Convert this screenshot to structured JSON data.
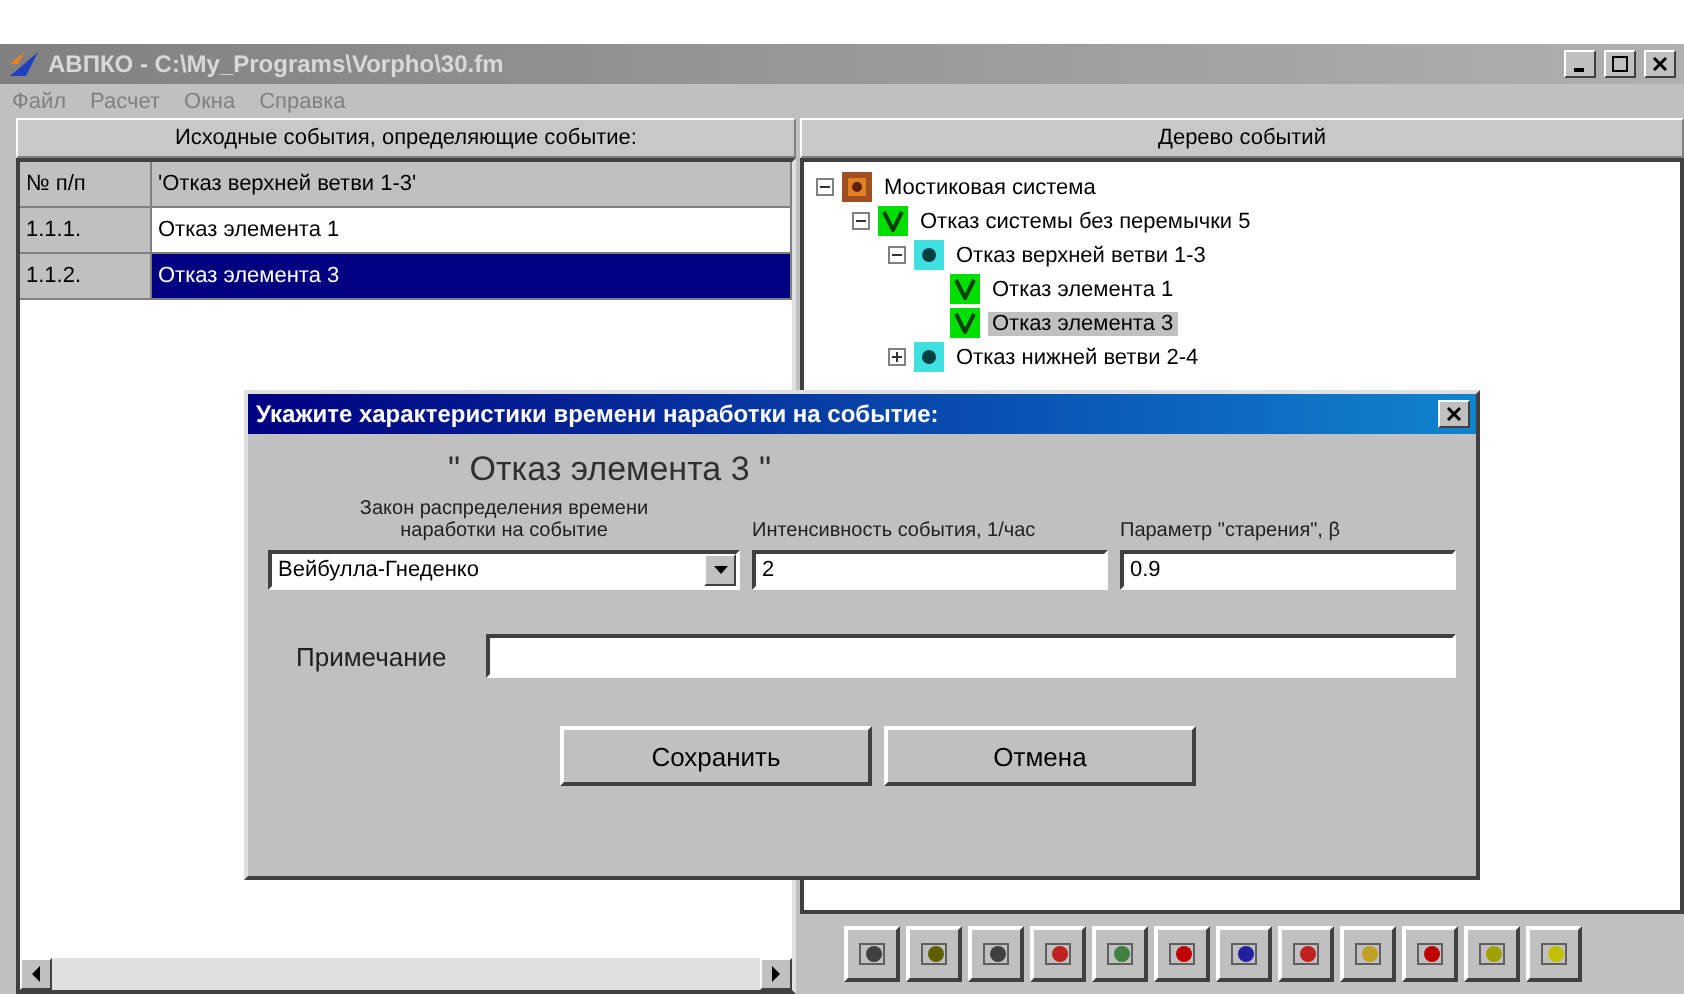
{
  "window": {
    "title": "АВПКО - C:\\My_Programs\\Vorpho\\30.fm"
  },
  "menu": [
    "Файл",
    "Расчет",
    "Окна",
    "Справка"
  ],
  "left_panel": {
    "title": "Исходные события, определяющие событие:",
    "columns": [
      "№ п/п",
      "'Отказ верхней ветви 1-3'"
    ],
    "rows": [
      {
        "number": "1.1.1.",
        "name": "Отказ элемента 1",
        "selected": false
      },
      {
        "number": "1.1.2.",
        "name": "Отказ элемента 3",
        "selected": true
      }
    ]
  },
  "right_panel": {
    "title": "Дерево событий",
    "tree": [
      {
        "label": "Мостиковая система",
        "kind": "system",
        "expanded": true,
        "selected": false,
        "children": [
          {
            "label": "Отказ системы без перемычки 5",
            "kind": "or",
            "expanded": true,
            "selected": false,
            "children": [
              {
                "label": "Отказ верхней ветви 1-3",
                "kind": "and",
                "expanded": true,
                "selected": false,
                "children": [
                  {
                    "label": "Отказ элемента 1",
                    "kind": "or",
                    "selected": false
                  },
                  {
                    "label": "Отказ элемента 3",
                    "kind": "or",
                    "selected": true
                  }
                ]
              },
              {
                "label": "Отказ нижней ветви 2-4",
                "kind": "and",
                "expanded": false,
                "selected": false
              }
            ]
          }
        ]
      }
    ]
  },
  "dialog": {
    "title": "Укажите характеристики времени наработки на событие:",
    "event": "\" Отказ элемента 3 \"",
    "law_label": "Закон распределения времени наработки на событие",
    "law_value": "Вейбулла-Гнеденко",
    "intensity_label": "Интенсивность события, 1/час",
    "intensity_value": "2",
    "param_label": "Параметр \"старения\", β",
    "param_value": "0.9",
    "note_label": "Примечание",
    "buttons": [
      "Сохранить",
      "Отмена"
    ]
  }
}
